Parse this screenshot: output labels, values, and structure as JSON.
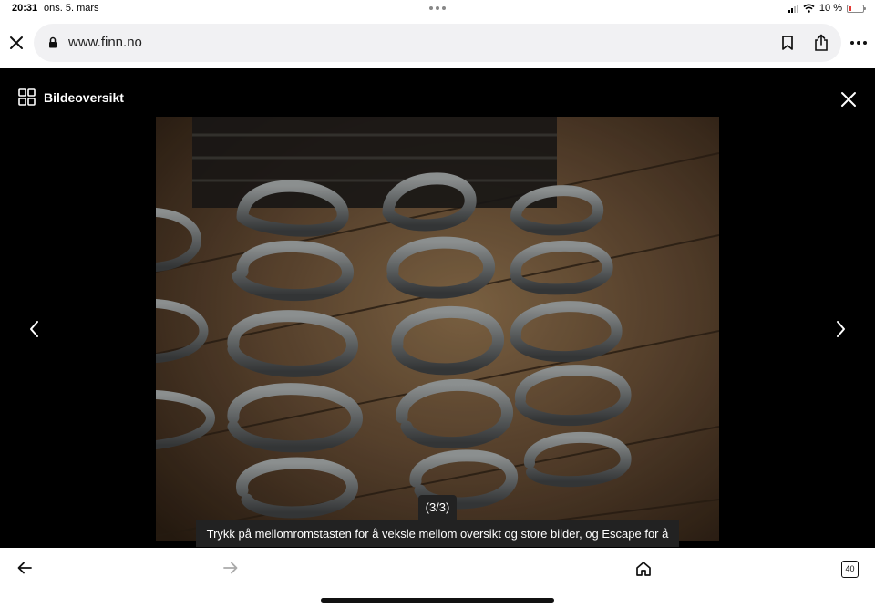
{
  "status": {
    "time": "20:31",
    "date": "ons. 5. mars",
    "battery": "10 %",
    "battery_level": 0.1
  },
  "browser": {
    "url": "www.finn.no"
  },
  "viewer": {
    "overview_label": "Bildeoversikt",
    "counter": "(3/3)",
    "hint": "Trykk på mellomromstasten for å veksle mellom oversikt og store bilder, og Escape for å lukke."
  },
  "toolbar": {
    "tabs_count": "40"
  },
  "icons": {
    "close": "close-icon",
    "lock": "lock-icon",
    "bookmark": "bookmark-icon",
    "share": "share-icon",
    "more": "more-icon",
    "grid": "grid-icon",
    "prev": "chevron-left-icon",
    "next": "chevron-right-icon",
    "back": "arrow-left-icon",
    "forward": "arrow-right-icon",
    "home": "home-icon"
  }
}
